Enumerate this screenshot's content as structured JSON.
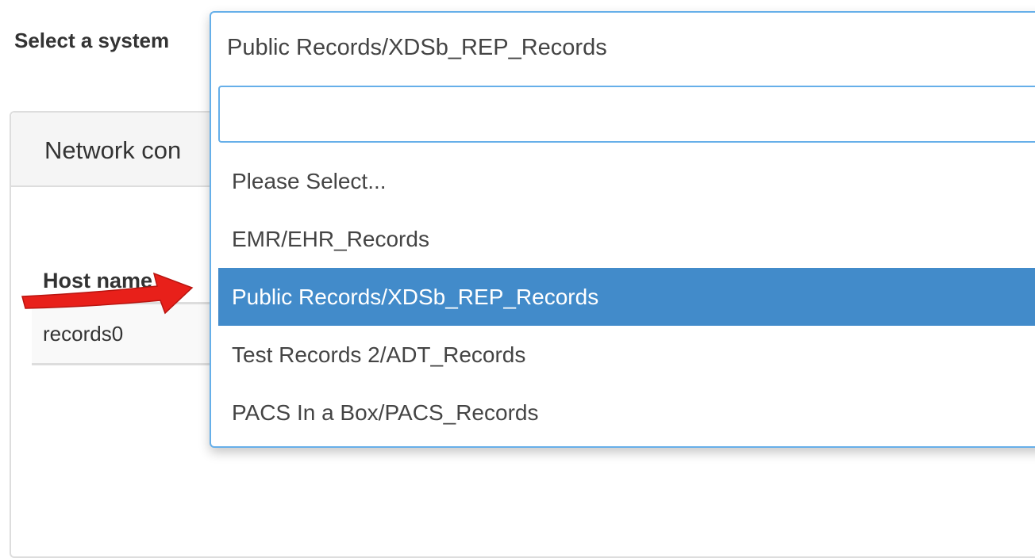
{
  "filter": {
    "label": "Select a system",
    "selected_value": "Public Records/XDSb_REP_Records",
    "search_value": "",
    "options": [
      "Please Select...",
      "EMR/EHR_Records",
      "Public Records/XDSb_REP_Records",
      "Test Records 2/ADT_Records",
      "PACS In a Box/PACS_Records"
    ],
    "highlighted_option": "Public Records/XDSb_REP_Records"
  },
  "panel": {
    "heading": "Network con"
  },
  "table": {
    "headers": [
      "Host name"
    ],
    "rows": [
      [
        "records0"
      ]
    ]
  },
  "annotation": {
    "arrow_color": "#e8201a"
  },
  "colors": {
    "highlight": "#428bca",
    "focus_border": "#66afe9"
  }
}
